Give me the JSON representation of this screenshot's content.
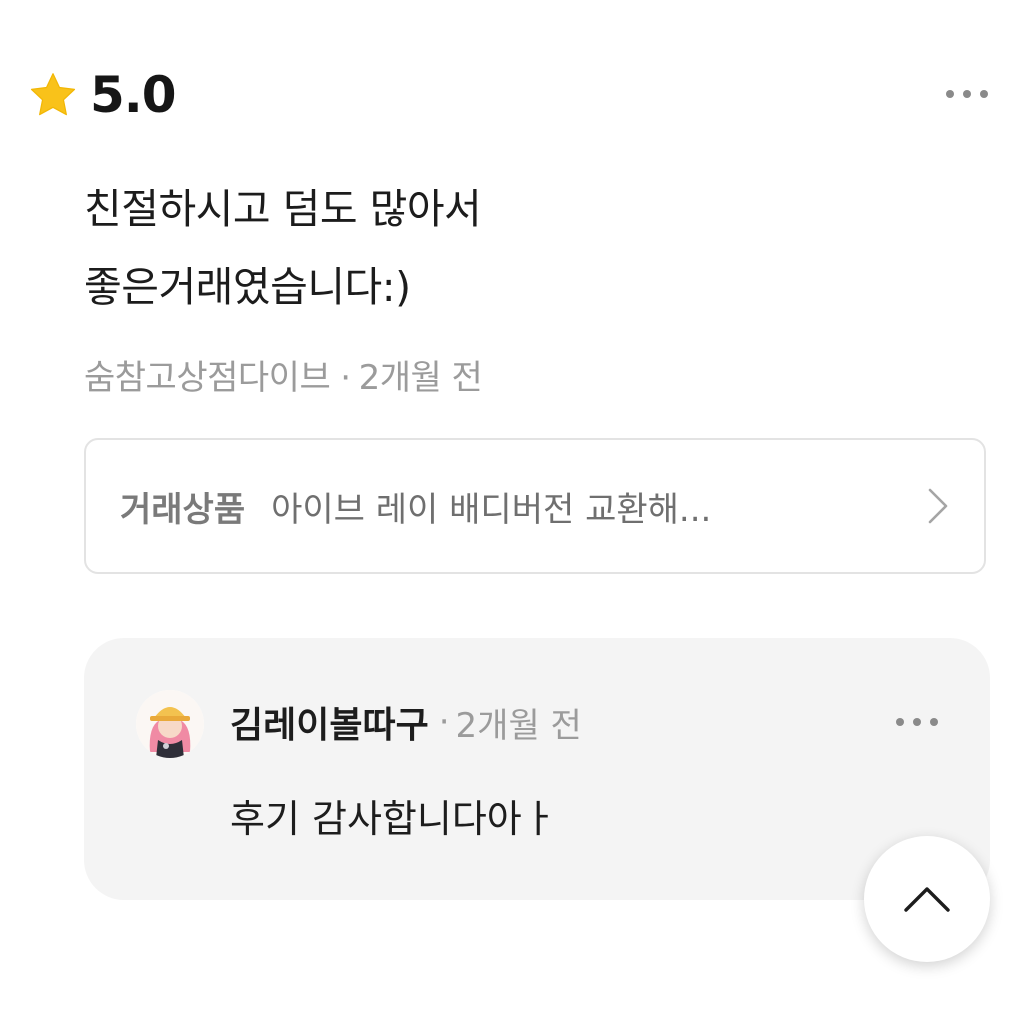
{
  "review": {
    "rating": "5.0",
    "text_lines": [
      "친절하시고 덤도 많아서",
      "좋은거래였습니다:)"
    ],
    "reviewer": "숨참고상점다이브",
    "separator": "·",
    "time_ago": "2개월 전"
  },
  "product": {
    "label": "거래상품",
    "name": "아이브 레이 배디버전 교환해..."
  },
  "reply": {
    "author": "김레이볼따구",
    "separator": "·",
    "time_ago": "2개월 전",
    "text": "후기 감사합니다아ㅏ"
  },
  "colors": {
    "star": "#F9C21A",
    "reply_background": "#F4F4F4",
    "meta_text": "#9B9B9B"
  },
  "icons": [
    "star-icon",
    "more-options-icon",
    "chevron-right-icon",
    "chevron-up-icon",
    "avatar"
  ]
}
